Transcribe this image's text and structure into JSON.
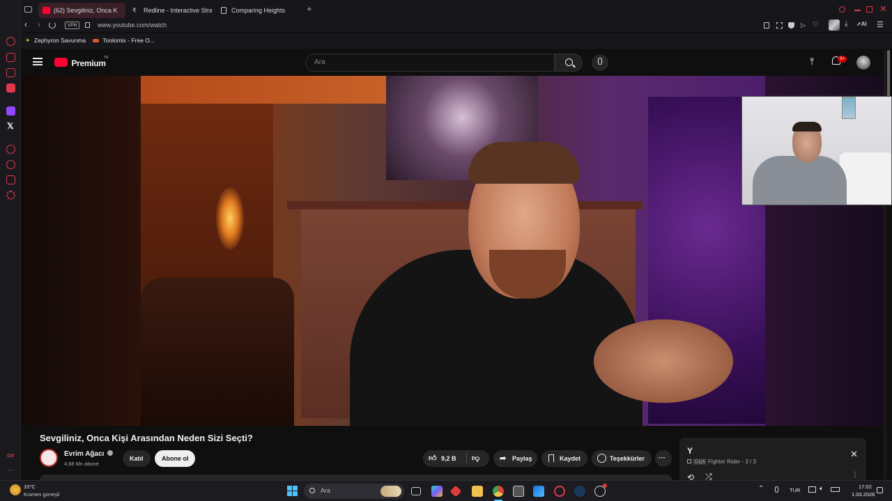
{
  "browser": {
    "tabs": [
      {
        "label": "(62) Sevgiliniz, Onca K",
        "active": true
      },
      {
        "label": "Redline - Interactive Strat",
        "active": false
      },
      {
        "label": "Comparing Heights",
        "active": false
      }
    ],
    "vpn_badge": "VPN",
    "url": "www.youtube.com/watch",
    "bookmarks": [
      "Zephyron Savunma",
      "Toolomix - Free O..."
    ],
    "toolbar_ai_label": "AI",
    "sidebar_gx_label": "GX"
  },
  "youtube": {
    "logo_text": "Premium",
    "region": "TR",
    "search_placeholder": "Ara",
    "notification_count": "9+",
    "video": {
      "title": "Sevgiliniz, Onca Kişi Arasından Neden Sizi Seçti?",
      "channel_name": "Evrim Ağacı",
      "subscribers": "4,68 Mn abone",
      "join_label": "Katıl",
      "subscribe_label": "Abone ol",
      "likes": "9,2 B",
      "share_label": "Paylaş",
      "save_label": "Kaydet",
      "thanks_label": "Teşekkürler",
      "more_label": "···"
    },
    "mini_panel": {
      "title": "Y",
      "privacy": "Gizli",
      "playlist_name": "Fighter Rider",
      "position": "- 3 / 3"
    }
  },
  "taskbar": {
    "weather_temp": "10°C",
    "weather_desc": "Kısmen güneşli",
    "search_placeholder": "Ara",
    "language": "TUR",
    "time": "17:02",
    "date": "1.03.2026"
  },
  "colors": {
    "accent_red": "#ff0033",
    "opera_red": "#e0384a"
  }
}
